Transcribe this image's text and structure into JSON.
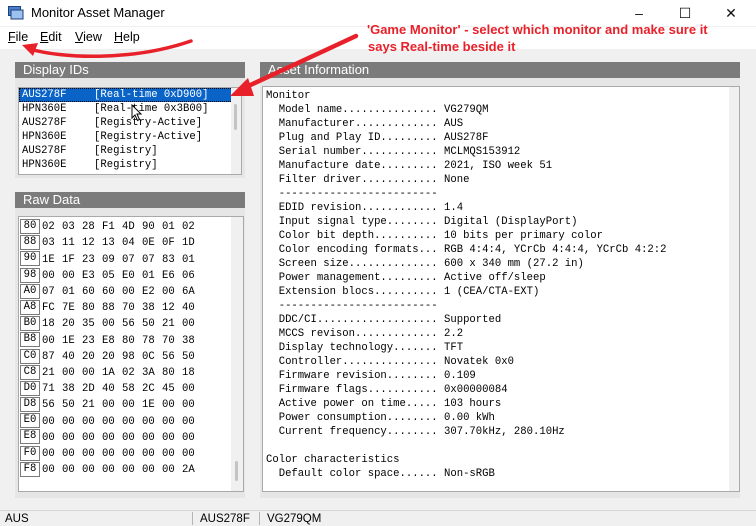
{
  "window": {
    "title": "Monitor Asset Manager",
    "controls": [
      "–",
      "☐",
      "✕"
    ]
  },
  "menu": [
    {
      "label": "File",
      "mnemonic": "F",
      "rest": "ile"
    },
    {
      "label": "Edit",
      "mnemonic": "E",
      "rest": "dit"
    },
    {
      "label": "View",
      "mnemonic": "V",
      "rest": "iew"
    },
    {
      "label": "Help",
      "mnemonic": "H",
      "rest": "elp"
    }
  ],
  "annotation": {
    "text_line1": "'Game Monitor' - select which monitor and make sure it",
    "text_line2": "says Real-time beside it",
    "color": "#e8202a"
  },
  "display_ids": {
    "header": "Display IDs",
    "rows": [
      {
        "id": "AUS278F",
        "mode": "[Real-time 0xD900]",
        "selected": true
      },
      {
        "id": "HPN360E",
        "mode": "[Real-time 0x3B00]",
        "selected": false
      },
      {
        "id": "AUS278F",
        "mode": "[Registry-Active]",
        "selected": false
      },
      {
        "id": "HPN360E",
        "mode": "[Registry-Active]",
        "selected": false
      },
      {
        "id": "AUS278F",
        "mode": "[Registry]",
        "selected": false
      },
      {
        "id": "HPN360E",
        "mode": "[Registry]",
        "selected": false
      }
    ]
  },
  "raw_data": {
    "header": "Raw Data",
    "rows": [
      {
        "addr": "80",
        "bytes": [
          "02",
          "03",
          "28",
          "F1",
          "4D",
          "90",
          "01",
          "02"
        ]
      },
      {
        "addr": "88",
        "bytes": [
          "03",
          "11",
          "12",
          "13",
          "04",
          "0E",
          "0F",
          "1D"
        ]
      },
      {
        "addr": "90",
        "bytes": [
          "1E",
          "1F",
          "23",
          "09",
          "07",
          "07",
          "83",
          "01"
        ]
      },
      {
        "addr": "98",
        "bytes": [
          "00",
          "00",
          "E3",
          "05",
          "E0",
          "01",
          "E6",
          "06"
        ]
      },
      {
        "addr": "A0",
        "bytes": [
          "07",
          "01",
          "60",
          "60",
          "00",
          "E2",
          "00",
          "6A"
        ]
      },
      {
        "addr": "A8",
        "bytes": [
          "FC",
          "7E",
          "80",
          "88",
          "70",
          "38",
          "12",
          "40"
        ]
      },
      {
        "addr": "B0",
        "bytes": [
          "18",
          "20",
          "35",
          "00",
          "56",
          "50",
          "21",
          "00"
        ]
      },
      {
        "addr": "B8",
        "bytes": [
          "00",
          "1E",
          "23",
          "E8",
          "80",
          "78",
          "70",
          "38"
        ]
      },
      {
        "addr": "C0",
        "bytes": [
          "87",
          "40",
          "20",
          "20",
          "98",
          "0C",
          "56",
          "50"
        ]
      },
      {
        "addr": "C8",
        "bytes": [
          "21",
          "00",
          "00",
          "1A",
          "02",
          "3A",
          "80",
          "18"
        ]
      },
      {
        "addr": "D0",
        "bytes": [
          "71",
          "38",
          "2D",
          "40",
          "58",
          "2C",
          "45",
          "00"
        ]
      },
      {
        "addr": "D8",
        "bytes": [
          "56",
          "50",
          "21",
          "00",
          "00",
          "1E",
          "00",
          "00"
        ]
      },
      {
        "addr": "E0",
        "bytes": [
          "00",
          "00",
          "00",
          "00",
          "00",
          "00",
          "00",
          "00"
        ]
      },
      {
        "addr": "E8",
        "bytes": [
          "00",
          "00",
          "00",
          "00",
          "00",
          "00",
          "00",
          "00"
        ]
      },
      {
        "addr": "F0",
        "bytes": [
          "00",
          "00",
          "00",
          "00",
          "00",
          "00",
          "00",
          "00"
        ]
      },
      {
        "addr": "F8",
        "bytes": [
          "00",
          "00",
          "00",
          "00",
          "00",
          "00",
          "00",
          "2A"
        ]
      }
    ]
  },
  "asset_info": {
    "header": "Asset Information",
    "lines": [
      "Monitor",
      "  Model name............... VG279QM",
      "  Manufacturer............. AUS",
      "  Plug and Play ID......... AUS278F",
      "  Serial number............ MCLMQS153912",
      "  Manufacture date......... 2021, ISO week 51",
      "  Filter driver............ None",
      "  -------------------------",
      "  EDID revision............ 1.4",
      "  Input signal type........ Digital (DisplayPort)",
      "  Color bit depth.......... 10 bits per primary color",
      "  Color encoding formats... RGB 4:4:4, YCrCb 4:4:4, YCrCb 4:2:2",
      "  Screen size.............. 600 x 340 mm (27.2 in)",
      "  Power management......... Active off/sleep",
      "  Extension blocs.......... 1 (CEA/CTA-EXT)",
      "  -------------------------",
      "  DDC/CI................... Supported",
      "  MCCS revison............. 2.2",
      "  Display technology....... TFT",
      "  Controller............... Novatek 0x0",
      "  Firmware revision........ 0.109",
      "  Firmware flags........... 0x00000084",
      "  Active power on time..... 103 hours",
      "  Power consumption........ 0.00 kWh",
      "  Current frequency........ 307.70kHz, 280.10Hz",
      "",
      "Color characteristics",
      "  Default color space...... Non-sRGB"
    ]
  },
  "status": {
    "cell1": "AUS",
    "cell2": "AUS278F",
    "cell3": "VG279QM"
  }
}
